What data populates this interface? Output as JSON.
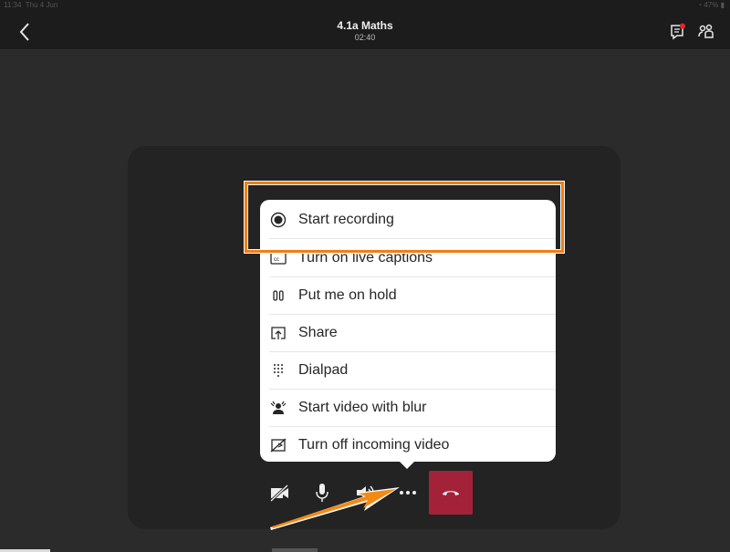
{
  "status_bar": {
    "time": "11:34",
    "date": "Thu 4 Jun",
    "battery": "47%"
  },
  "header": {
    "title": "4.1a Maths",
    "duration": "02:40",
    "chat_has_notification": true
  },
  "colors": {
    "accent_highlight": "#f07f14",
    "hangup": "#a3223a",
    "notification_dot": "#e0252b"
  },
  "menu": {
    "items": [
      {
        "label": "Start recording",
        "icon": "record-icon"
      },
      {
        "label": "Turn on live captions",
        "icon": "captions-icon"
      },
      {
        "label": "Put me on hold",
        "icon": "hold-icon"
      },
      {
        "label": "Share",
        "icon": "share-icon"
      },
      {
        "label": "Dialpad",
        "icon": "dialpad-icon"
      },
      {
        "label": "Start video with blur",
        "icon": "blur-icon"
      },
      {
        "label": "Turn off incoming video",
        "icon": "video-off-icon"
      }
    ]
  },
  "controls": {
    "camera": "camera-off-icon",
    "mic": "microphone-icon",
    "speaker": "speaker-icon",
    "more": "more-icon",
    "hangup": "hang-up-icon"
  }
}
